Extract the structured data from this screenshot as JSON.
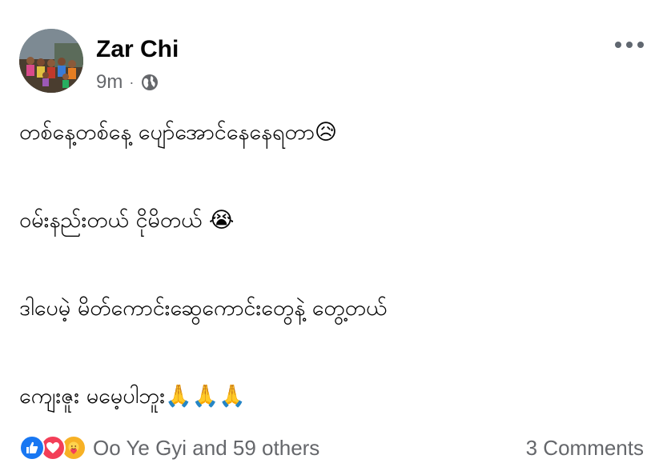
{
  "post": {
    "author": "Zar Chi",
    "time": "9m",
    "separator": "·",
    "privacy_icon": "globe-icon",
    "more_icon": "more-options-icon",
    "lines": [
      "တစ်နေ့တစ်နေ့ ပျော်အောင်နေနေရတာ😥",
      "ဝမ်းနည်းတယ် ငိုမိတယ် 😭",
      "ဒါပေမဲ့ မိတ်ကောင်းဆွေကောင်းတွေနဲ့ တွေ့တယ်",
      "ကျေးဇူး မမေ့ပါဘူး🙏🙏🙏"
    ]
  },
  "footer": {
    "reaction_icons": [
      "like-icon",
      "love-icon",
      "care-icon"
    ],
    "reactions_text": "Oo Ye Gyi and 59 others",
    "comments_text": "3 Comments"
  },
  "colors": {
    "text_primary": "#050505",
    "text_secondary": "#65676b",
    "like_blue": "#1877f2",
    "love_red": "#f33e58",
    "care_yellow": "#f7b125"
  }
}
